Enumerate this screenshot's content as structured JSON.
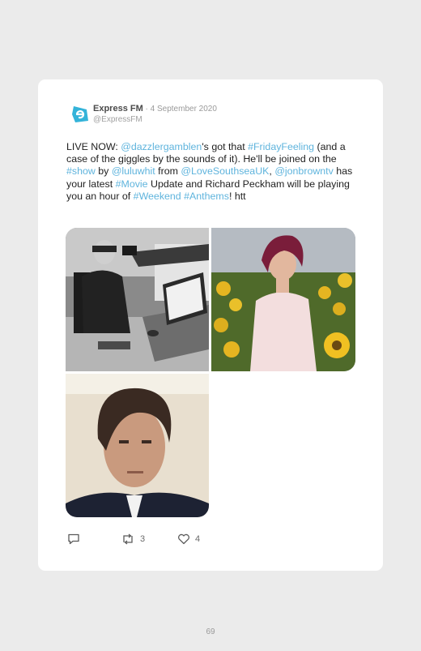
{
  "tweet": {
    "display_name": "Express FM",
    "date": " · 4 September 2020",
    "handle": "@ExpressFM",
    "text": {
      "t1": "LIVE NOW: ",
      "m1": "@dazzlergamblen",
      "t2": "'s got that ",
      "h1": "#FridayFeeling",
      "t3": " (and a case of the giggles by the sounds of it). He'll be joined on the ",
      "h2": "#show",
      "t4": " by ",
      "m2": "@luluwhit",
      "t5": " from ",
      "m3": "@LoveSouthseaUK",
      "t6": ", ",
      "m4": "@jonbrowntv",
      "t7": " has your latest ",
      "h3": "#Movie",
      "t8": " Update and Richard Peckham will be playing you an hour of ",
      "h4": "#Weekend",
      "t9": " ",
      "h5": "#Anthems",
      "t10": "! htt"
    },
    "retweets": "3",
    "likes": "4",
    "colors": {
      "link": "#5fb4dd",
      "logo": "#34b3d9"
    }
  },
  "page_number": "69"
}
